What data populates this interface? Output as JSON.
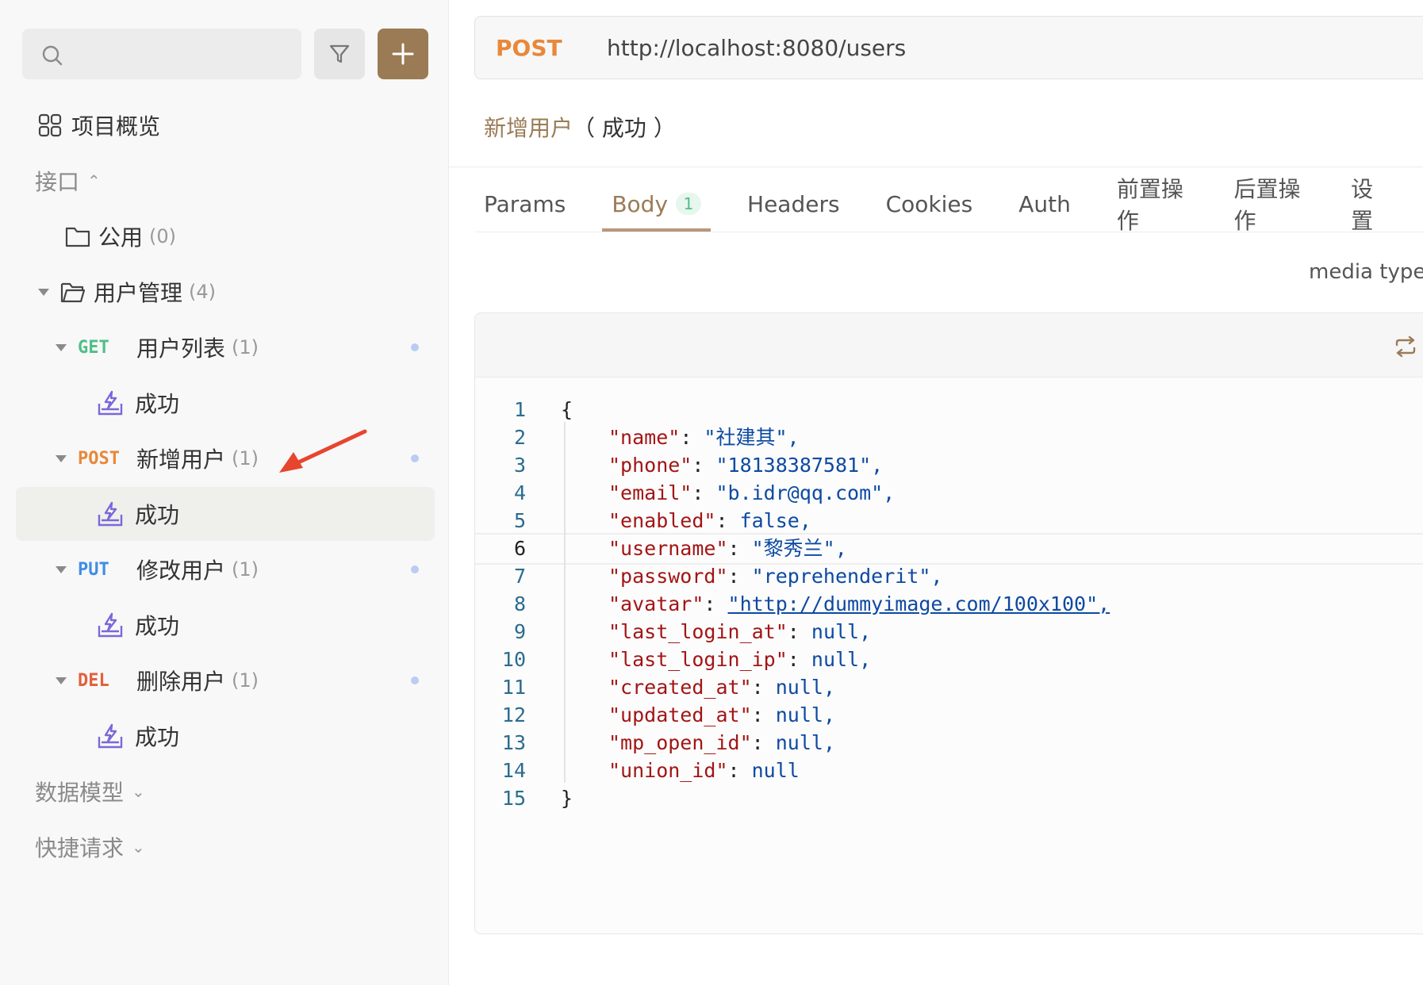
{
  "sidebar": {
    "overview_label": "项目概览",
    "interface_section": "接口",
    "folders": [
      {
        "name": "公用",
        "count": "(0)"
      },
      {
        "name": "用户管理",
        "count": "(4)"
      }
    ],
    "endpoints": [
      {
        "method": "GET",
        "name": "用户列表",
        "count": "(1)",
        "example": "成功"
      },
      {
        "method": "POST",
        "name": "新增用户",
        "count": "(1)",
        "example": "成功"
      },
      {
        "method": "PUT",
        "name": "修改用户",
        "count": "(1)",
        "example": "成功"
      },
      {
        "method": "DEL",
        "name": "删除用户",
        "count": "(1)",
        "example": "成功"
      }
    ],
    "data_model_section": "数据模型",
    "quick_request_section": "快捷请求"
  },
  "request": {
    "method": "POST",
    "url": "http://localhost:8080/users",
    "name": "新增用户",
    "status": "（ 成功 ）"
  },
  "tabs": [
    {
      "label": "Params"
    },
    {
      "label": "Body",
      "badge": "1"
    },
    {
      "label": "Headers"
    },
    {
      "label": "Cookies"
    },
    {
      "label": "Auth"
    },
    {
      "label": "前置操作"
    },
    {
      "label": "后置操作"
    },
    {
      "label": "设置"
    }
  ],
  "media_type_label": "media type",
  "body_lines": [
    {
      "n": "1",
      "key": "",
      "val": "",
      "raw": "{"
    },
    {
      "n": "2",
      "key": "\"name\"",
      "val": "\"社建其\","
    },
    {
      "n": "3",
      "key": "\"phone\"",
      "val": "\"18138387581\","
    },
    {
      "n": "4",
      "key": "\"email\"",
      "val": "\"b.idr@qq.com\","
    },
    {
      "n": "5",
      "key": "\"enabled\"",
      "val": "false,"
    },
    {
      "n": "6",
      "key": "\"username\"",
      "val": "\"黎秀兰\","
    },
    {
      "n": "7",
      "key": "\"password\"",
      "val": "\"reprehenderit\","
    },
    {
      "n": "8",
      "key": "\"avatar\"",
      "val": "\"http://dummyimage.com/100x100\","
    },
    {
      "n": "9",
      "key": "\"last_login_at\"",
      "val": "null,"
    },
    {
      "n": "10",
      "key": "\"last_login_ip\"",
      "val": "null,"
    },
    {
      "n": "11",
      "key": "\"created_at\"",
      "val": "null,"
    },
    {
      "n": "12",
      "key": "\"updated_at\"",
      "val": "null,"
    },
    {
      "n": "13",
      "key": "\"mp_open_id\"",
      "val": "null,"
    },
    {
      "n": "14",
      "key": "\"union_id\"",
      "val": "null"
    },
    {
      "n": "15",
      "key": "",
      "val": "",
      "raw": "}"
    }
  ],
  "colors": {
    "accent": "#9b7b55",
    "get": "#4fbf86",
    "post": "#e8883a",
    "put": "#3f8de6",
    "del": "#e2603b",
    "annotation_arrow": "#e8452f"
  }
}
